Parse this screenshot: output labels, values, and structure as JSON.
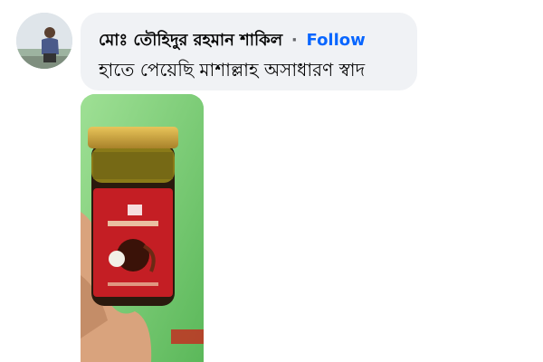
{
  "comment": {
    "author_name": "মোঃ তৌহিদুর রহমান শাকিল",
    "separator": "·",
    "follow_label": "Follow",
    "text": "হাতে পেয়েছি মাশাল্লাহ অসাধারণ স্বাদ",
    "avatar_icon": "user-avatar-photo",
    "attachment_icon": "product-photo-jar"
  },
  "colors": {
    "bubble": "#f0f2f5",
    "follow": "#0866ff",
    "text": "#050505",
    "photo_bg": "#8fd886",
    "label_red": "#c41e24"
  }
}
